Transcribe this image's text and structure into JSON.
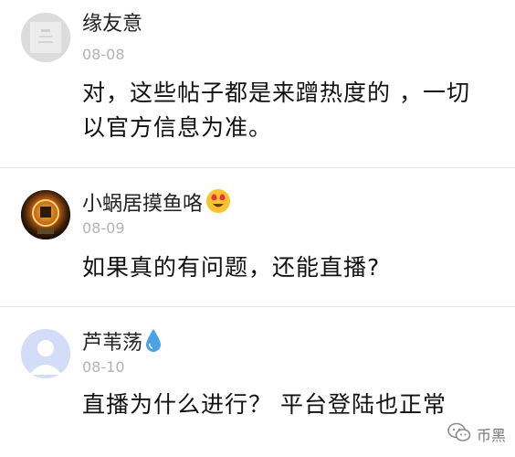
{
  "comments": [
    {
      "username": "缘友意",
      "date": "08-08",
      "text_line1": "对，这些帖子都是来蹭热度的 ，一切",
      "text_line2": "以官方信息为准。",
      "avatar_style": "blank-gray",
      "badge_icon": ""
    },
    {
      "username": "小蜗居摸鱼咯",
      "date": "08-09",
      "text_line1": "如果真的有问题，还能直播?",
      "avatar_style": "dark-flame-logo",
      "badge_icon": "heart-eyes-emoji-icon"
    },
    {
      "username": "芦苇荡",
      "date": "08-10",
      "text_line1": "直播为什么进行？ 平台登陆也正常",
      "avatar_style": "default-person",
      "badge_icon": "water-drop-icon"
    }
  ],
  "watermark": {
    "label": "币黑",
    "icon": "wechat-logo-icon"
  },
  "colors": {
    "date_gray": "#b3b3b3",
    "divider": "#e6e6e6",
    "default_avatar_bg": "#d4ddf7",
    "water_drop": "#4aa3e6",
    "emoji_yellow": "#f7c32e"
  }
}
